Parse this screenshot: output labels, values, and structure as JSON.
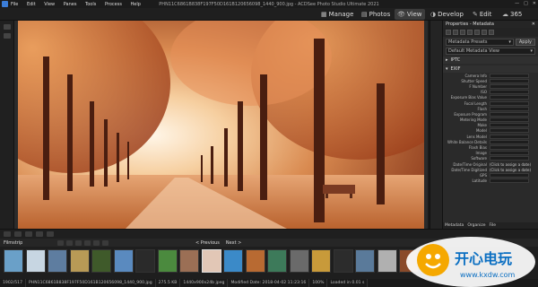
{
  "window": {
    "title": "PHN11C6861B838F197F50D161B120656098_1440_900.jpg - ACDSee Photo Studio Ultimate 2021",
    "menu": [
      "File",
      "Edit",
      "View",
      "Panes",
      "Tools",
      "Process",
      "Help"
    ]
  },
  "modes": [
    {
      "label": "Manage",
      "icon": "manage-icon",
      "active": false
    },
    {
      "label": "Photos",
      "icon": "photos-icon",
      "active": false
    },
    {
      "label": "View",
      "icon": "view-icon",
      "active": true
    },
    {
      "label": "Develop",
      "icon": "develop-icon",
      "active": false
    },
    {
      "label": "Edit",
      "icon": "edit-icon",
      "active": false
    },
    {
      "label": "365",
      "icon": "cloud-icon",
      "active": false
    }
  ],
  "properties": {
    "title": "Properties - Metadata",
    "view_select": "Metadata Presets",
    "apply_label": "Apply",
    "file_select": "Default Metadata View",
    "sections": {
      "iptc": "IPTC",
      "exif": "EXIF"
    },
    "exif_fields": [
      {
        "label": "Camera Info",
        "value": ""
      },
      {
        "label": "Shutter Speed",
        "value": ""
      },
      {
        "label": "F Number",
        "value": ""
      },
      {
        "label": "ISO",
        "value": ""
      },
      {
        "label": "Exposure Bias Value",
        "value": ""
      },
      {
        "label": "Focal Length",
        "value": ""
      },
      {
        "label": "Flash",
        "value": ""
      },
      {
        "label": "Exposure Program",
        "value": ""
      },
      {
        "label": "Metering Mode",
        "value": ""
      },
      {
        "label": "Make",
        "value": ""
      },
      {
        "label": "Model",
        "value": ""
      },
      {
        "label": "Lens Model",
        "value": ""
      },
      {
        "label": "White Balance Details",
        "value": ""
      },
      {
        "label": "Flash Bias",
        "value": ""
      },
      {
        "label": "Image",
        "value": ""
      },
      {
        "label": "Software",
        "value": ""
      },
      {
        "label": "Date/Time Original",
        "value": "(Click to assign a date)"
      },
      {
        "label": "Date/Time Digitized",
        "value": "(Click to assign a date)"
      },
      {
        "label": "GPS",
        "value": ""
      },
      {
        "label": "Latitude",
        "value": ""
      }
    ],
    "bottom_tabs": [
      "Metadata",
      "Organize",
      "File"
    ]
  },
  "filmstrip": {
    "label": "Filmstrip",
    "previous": "< Previous",
    "next": "Next >",
    "thumbs": [
      "#6aa0c8",
      "#c7d6e2",
      "#5e7da0",
      "#b89a56",
      "#3f5a2a",
      "#5a8abf",
      "#2a2a2a",
      "#4b8a3e",
      "#9b6f55",
      "#e2c7b6",
      "#3b8ac8",
      "#b86a32",
      "#3d7a5a",
      "#6a6a6a",
      "#c89a3a",
      "#2c2c2c",
      "#5a7a9a",
      "#b0b0b0",
      "#8a4a2a"
    ],
    "selected_index": 9
  },
  "status": {
    "index": "1902/517",
    "filename": "PHN11C6861B838F197F50D161B120656098_1440_900.jpg",
    "size": "275.5 KB",
    "dims": "1440x900x24b jpeg",
    "modified": "Modified Date: 2018-04-02 11:23:16",
    "zoom": "100%",
    "loaded": "Loaded in 0.01 s"
  },
  "watermark": {
    "name": "开心电玩",
    "url": "www.kxdw.com"
  }
}
